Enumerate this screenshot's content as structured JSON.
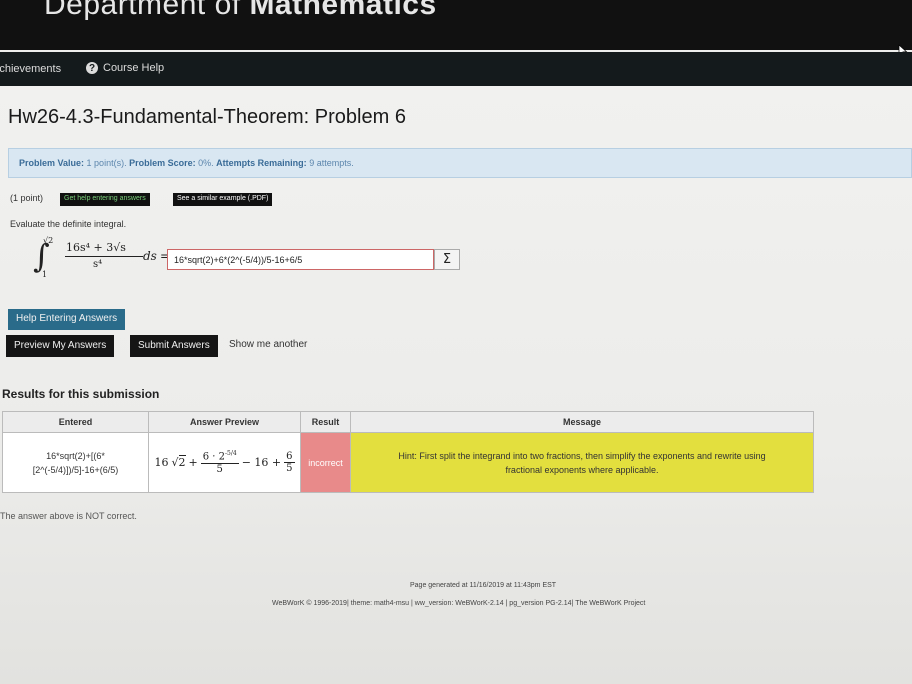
{
  "masthead": {
    "dept_prefix": "Department of ",
    "dept_bold": "Mathematics"
  },
  "nav": {
    "achievements": "Achievements",
    "course_help": "Course Help",
    "help_icon_glyph": "?"
  },
  "problem": {
    "title": "Hw26-4.3-Fundamental-Theorem: Problem 6",
    "status": {
      "value_label": "Problem Value:",
      "value": "1 point(s).",
      "score_label": "Problem Score:",
      "score": "0%.",
      "attempts_label": "Attempts Remaining:",
      "attempts": "9 attempts."
    },
    "points": "(1 point)",
    "help_entering_btn": "Get help entering answers",
    "similar_example_btn": "See a similar example (.PDF)",
    "instruction": "Evaluate the definite integral.",
    "integral": {
      "upper": "√2",
      "lower": "1",
      "numerator": "16s⁴ + 3√s",
      "denominator": "s⁴",
      "ds": "ds",
      "equals": "="
    },
    "answer_value": "16*sqrt(2)+6*(2^(-5/4))/5-16+6/5",
    "sigma": "Σ"
  },
  "buttons": {
    "help_entering": "Help Entering Answers",
    "preview": "Preview My Answers",
    "submit": "Submit Answers",
    "show_another": "Show me another"
  },
  "results": {
    "heading": "Results for this submission",
    "headers": [
      "Entered",
      "Answer Preview",
      "Result",
      "Message"
    ],
    "entered_line1": "16*sqrt(2)+[(6*",
    "entered_line2": "[2^(-5/4)])/5]-16+(6/5)",
    "preview": {
      "coef": "16",
      "root": "2",
      "plus1": "+",
      "num": "6 · 2",
      "exp": "-5/4",
      "den": "5",
      "minus": "− 16 +",
      "num2": "6",
      "den2": "5"
    },
    "result": "incorrect",
    "message_line1": "Hint: First split the integrand into two fractions, then simplify the exponents and rewrite using",
    "message_line2": "fractional exponents where applicable.",
    "verdict": "The answer above is NOT correct."
  },
  "footer": {
    "generated": "Page generated at 11/16/2019 at 11:43pm EST",
    "version": "WeBWorK © 1996-2019| theme: math4-msu | ww_version: WeBWorK-2.14 | pg_version PG-2.14| The WeBWorK Project"
  },
  "colors": {
    "incorrect": "#e88a8a",
    "hint": "#e3df3e",
    "status_bg": "#d9e7f2",
    "teal_button": "#2a6b8a"
  }
}
